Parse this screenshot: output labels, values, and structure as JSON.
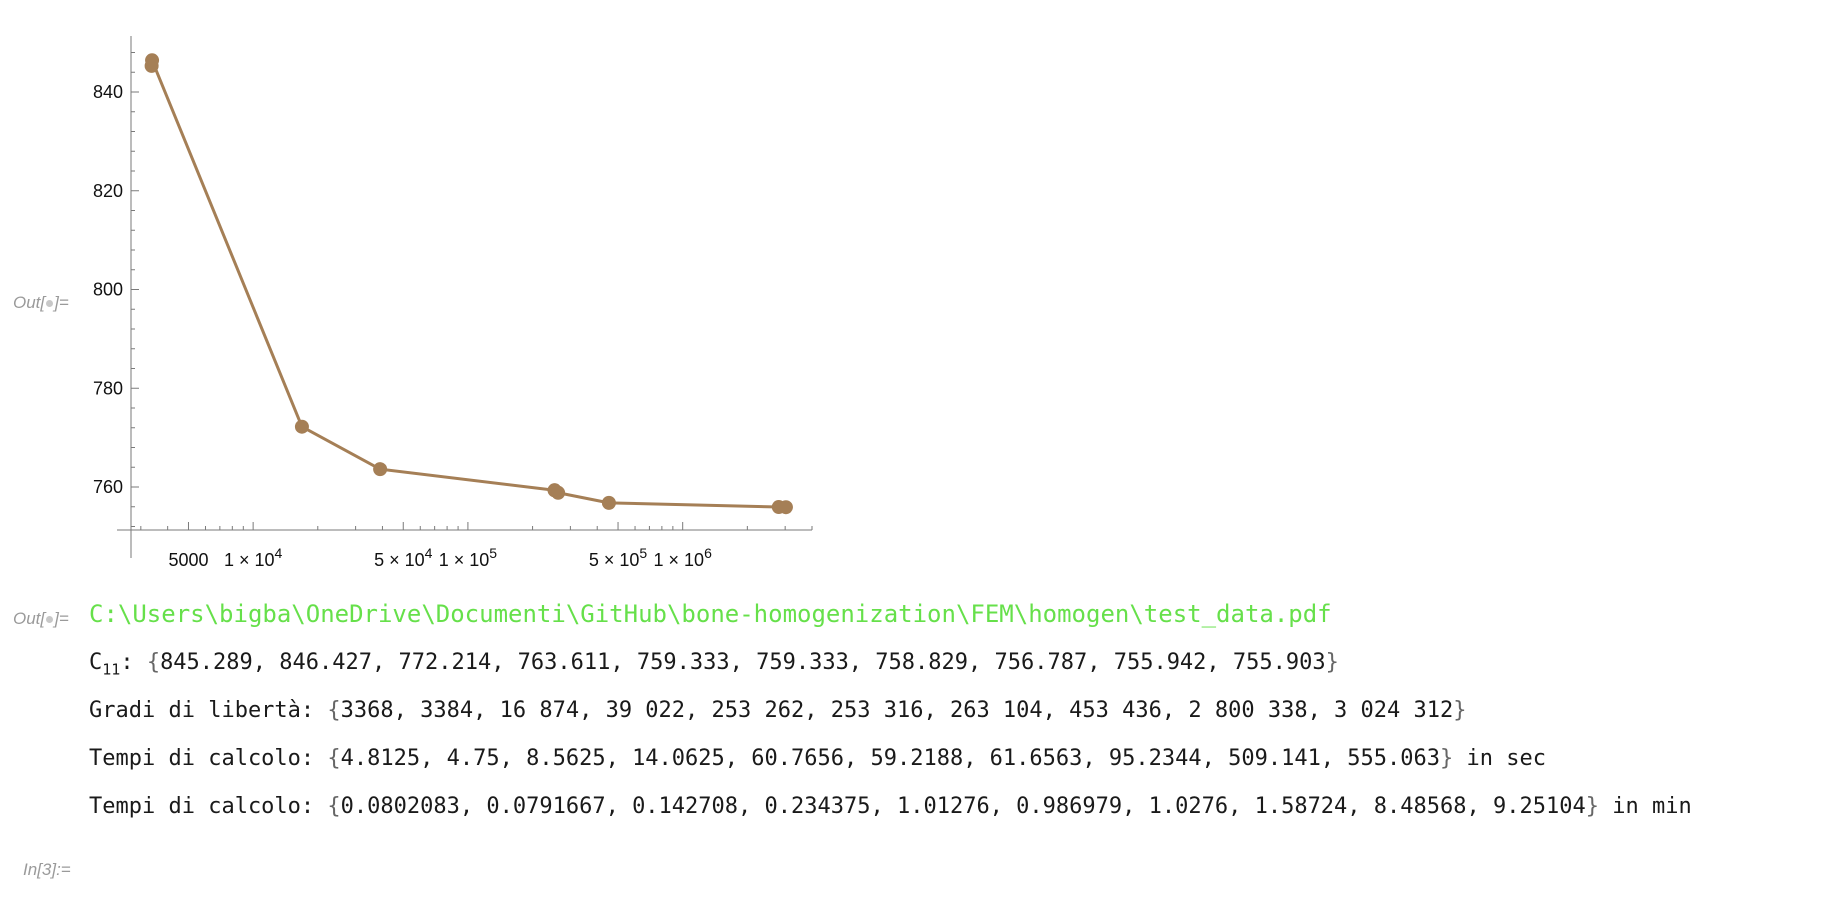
{
  "labels": {
    "out1": "Out[",
    "out1_end": "]=",
    "out2": "Out[",
    "out2_end": "]=",
    "in3": "In[3]:="
  },
  "chart_data": {
    "type": "line",
    "x_scale": "log",
    "xlim": [
      2700,
      4000000
    ],
    "ylim": [
      750.5,
      849
    ],
    "y_ticks": [
      760,
      780,
      800,
      820,
      840
    ],
    "y_tick_labels": [
      "760",
      "780",
      "800",
      "820",
      "840"
    ],
    "x_tick_labels": [
      {
        "value": 5000,
        "text": "5000"
      },
      {
        "value": 10000,
        "text": "1 × 10",
        "sup": "4"
      },
      {
        "value": 50000,
        "text": "5 × 10",
        "sup": "4"
      },
      {
        "value": 100000,
        "text": "1 × 10",
        "sup": "5"
      },
      {
        "value": 500000,
        "text": "5 × 10",
        "sup": "5"
      },
      {
        "value": 1000000,
        "text": "1 × 10",
        "sup": "6"
      }
    ],
    "color": "#a57f56",
    "x": [
      3368,
      3384,
      16874,
      39022,
      253262,
      253316,
      263104,
      453436,
      2800338,
      3024312
    ],
    "y": [
      845.289,
      846.427,
      772.214,
      763.611,
      759.333,
      759.333,
      758.829,
      756.787,
      755.942,
      755.903
    ]
  },
  "output": {
    "file_path": "C:\\Users\\bigba\\OneDrive\\Documenti\\GitHub\\bone-homogenization\\FEM\\homogen\\test_data.pdf",
    "c11_label_main": "C",
    "c11_label_sub": "11",
    "c11_sep": ": ",
    "c11_values": "845.289, 846.427, 772.214, 763.611, 759.333, 759.333, 758.829, 756.787, 755.942, 755.903",
    "dof_label": "Gradi di libertà: ",
    "dof_values": "3368, 3384, 16 874, 39 022, 253 262, 253 316, 263 104, 453 436, 2 800 338, 3 024 312",
    "time_sec_label": "Tempi di calcolo: ",
    "time_sec_values": "4.8125, 4.75, 8.5625, 14.0625, 60.7656, 59.2188, 61.6563, 95.2344, 509.141, 555.063",
    "time_sec_unit": " in sec",
    "time_min_label": "Tempi di calcolo: ",
    "time_min_values": "0.0802083, 0.0791667, 0.142708, 0.234375, 1.01276, 0.986979, 1.0276, 1.58724, 8.48568, 9.25104",
    "time_min_unit": " in min",
    "brace_open": "{",
    "brace_close": "}"
  }
}
